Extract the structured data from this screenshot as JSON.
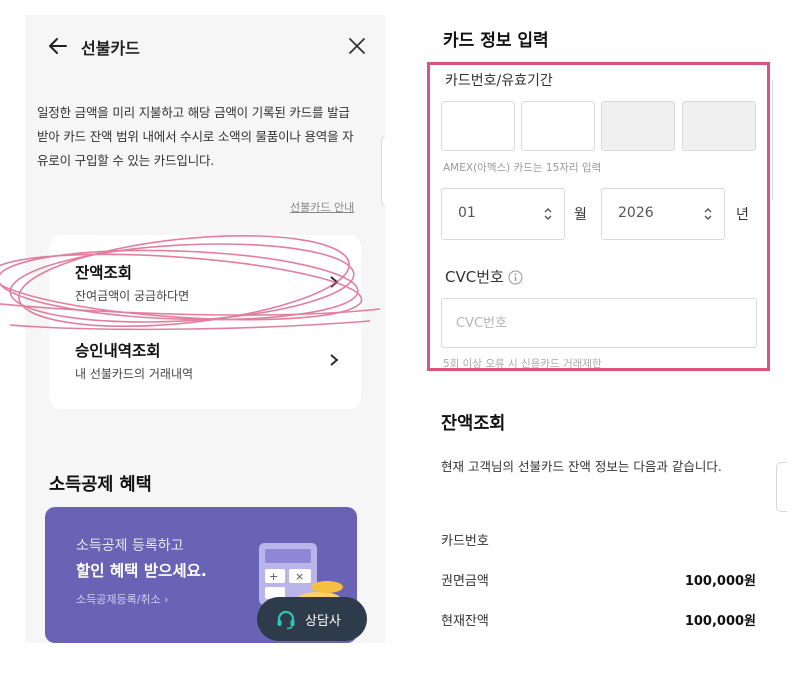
{
  "left": {
    "header": {
      "title": "선불카드"
    },
    "description": "일정한 금액을 미리 지불하고 해당 금액이 기록된 카드를 발급받아 카드 잔액 범위 내에서 수시로 소액의 물품이나 용역을 자유로이 구입할 수 있는 카드입니다.",
    "guide_link": "선불카드 안내",
    "menu": [
      {
        "title": "잔액조회",
        "subtitle": "잔여금액이 궁금하다면"
      },
      {
        "title": "승인내역조회",
        "subtitle": "내 선불카드의 거래내역"
      }
    ],
    "section_title": "소득공제 혜택",
    "banner": {
      "line1": "소득공제 등록하고",
      "line2": "할인 혜택 받으세요.",
      "link": "소득공제등록/취소 ›"
    },
    "chat_button": "상담사",
    "annotation_color": "#d8557e"
  },
  "right": {
    "title": "카드 정보 입력",
    "card_label": "카드번호/유효기간",
    "amex_note": "AMEX(아멕스) 카드는 15자리 입력",
    "month": {
      "value": "01",
      "unit": "월"
    },
    "year": {
      "value": "2026",
      "unit": "년"
    },
    "cvc_label": "CVC번호",
    "cvc_placeholder": "CVC번호",
    "error_note": "5회 이상 오류 시 신용카드 거래제한",
    "balance": {
      "title": "잔액조회",
      "description": "현재 고객님의 선불카드 잔액 정보는 다음과 같습니다.",
      "rows": [
        {
          "label": "카드번호",
          "value": ""
        },
        {
          "label": "권면금액",
          "value": "100,000원"
        },
        {
          "label": "현재잔액",
          "value": "100,000원"
        }
      ]
    },
    "highlight_color": "#d8557e"
  },
  "colors": {
    "banner": "#6a62b4",
    "chat": "#2d3b4a",
    "chat_accent": "#2ec4b6"
  }
}
